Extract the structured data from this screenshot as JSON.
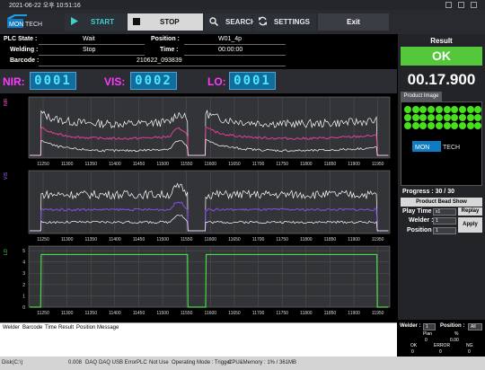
{
  "window": {
    "title": "2021-06-22 오후 10:51:16"
  },
  "logo": {
    "text_a": "MON",
    "text_b": "TECH"
  },
  "toolbar": {
    "start": "START",
    "stop": "STOP",
    "search": "SEARCH",
    "settings": "SETTINGS",
    "exit": "Exit"
  },
  "info": {
    "plc_state_label": "PLC State :",
    "plc_state": "Wait",
    "welding_label": "Welding :",
    "welding": "Stop",
    "barcode_label": "Barcode :",
    "barcode": "210622_093839",
    "position_label": "Position :",
    "position": "W01_4p",
    "time_label": "Time :",
    "time": "00:00:00"
  },
  "counters": [
    {
      "label": "NIR:",
      "value": "0001"
    },
    {
      "label": "VIS:",
      "value": "0002"
    },
    {
      "label": "LO:",
      "value": "0001"
    }
  ],
  "result": {
    "title": "Result",
    "value": "OK",
    "timer": "00.17.900"
  },
  "product": {
    "tab": "Product Image",
    "led_count": 30
  },
  "progress": {
    "label": "Progress : 30 / 30",
    "done": 30,
    "total": 30
  },
  "controls": {
    "bead_show": "Product Bead Show",
    "play_time_label": "Play Time :",
    "play_time": "x1",
    "replay": "Replay",
    "welder_label": "Welder :",
    "welder": "1",
    "position_label": "Position :",
    "position": "1",
    "apply": "Apply"
  },
  "log": {
    "columns": [
      "Welder",
      "Barcode",
      "Time",
      "Result",
      "Position",
      "Message"
    ]
  },
  "stats": {
    "welder_label": "Welder :",
    "welder": "1",
    "position_label": "Position :",
    "position": "All",
    "plan_label": "Plan",
    "plan": "0",
    "pct_label": "%",
    "pct": "0.00",
    "ok_label": "OK",
    "ok": "0",
    "error_label": "ERROR",
    "error": "0",
    "ng_label": "NG",
    "ng": "0"
  },
  "status": {
    "disk": "Disk(C:\\)",
    "value": "0.008",
    "daq": "DAQ",
    "daq_err": "DAQ USB Error",
    "plc": "PLC",
    "plc_state": "Not Use",
    "mode": "Operating Mode : Trigger",
    "cpu": "CPU&Memory : 1% / 361MB"
  },
  "chart_data": [
    {
      "type": "line",
      "ylabel": "NIR",
      "x_ticks": [
        11250,
        11300,
        11350,
        11400,
        11450,
        11500,
        11550,
        11600,
        11650,
        11700,
        11750,
        11800,
        11850,
        11900,
        11950
      ],
      "xlim": [
        11220,
        11975
      ],
      "series": [
        {
          "color": "#ffffff"
        },
        {
          "color": "#e0409a"
        },
        {
          "color": "#ffffff"
        }
      ]
    },
    {
      "type": "line",
      "ylabel": "VIS",
      "x_ticks": [
        11250,
        11300,
        11350,
        11400,
        11450,
        11500,
        11550,
        11600,
        11650,
        11700,
        11750,
        11800,
        11850,
        11900,
        11950
      ],
      "xlim": [
        11220,
        11975
      ],
      "series": [
        {
          "color": "#ffffff"
        },
        {
          "color": "#8a4de6"
        },
        {
          "color": "#ffffff"
        }
      ]
    },
    {
      "type": "line",
      "ylabel": "LO",
      "x_ticks": [
        11250,
        11300,
        11350,
        11400,
        11450,
        11500,
        11550,
        11600,
        11650,
        11700,
        11750,
        11800,
        11850,
        11900,
        11950
      ],
      "xlim": [
        11220,
        11975
      ],
      "y_ticks": [
        0,
        1,
        2,
        3,
        4,
        5
      ],
      "ylim": [
        0,
        5.4
      ],
      "series": [
        {
          "color": "#48d848"
        }
      ]
    }
  ]
}
